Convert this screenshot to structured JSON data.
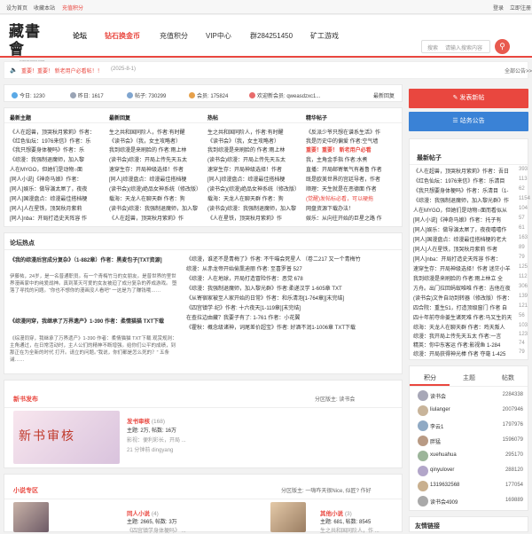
{
  "topbar": {
    "homepage": "设为首页",
    "bookmark": "收藏本站",
    "recharge": "充值积分",
    "login": "登录",
    "register": "立即注册"
  },
  "logo": {
    "text": "藏書會",
    "sub": "CANGSHUHUI.COM"
  },
  "nav": [
    "论坛",
    "钻石换金币",
    "充值积分",
    "VIP中心",
    "群284251450",
    "矿工游戏"
  ],
  "search": {
    "label": "搜索",
    "placeholder": "请输入搜索内容"
  },
  "notice": {
    "icon": "speaker-icon",
    "text": "重要！重要！ 新老用户必看帖！！",
    "date": "(2025-8-1)",
    "all": "全部公告>>"
  },
  "stats": {
    "today": "今日: 1230",
    "yesterday": "昨日: 1617",
    "posts": "帖子: 730299",
    "members": "会员: 175824",
    "welcome": "欢迎新会员: qweasdzxc1...",
    "latest": "最新回复"
  },
  "cols": [
    {
      "title": "最新主题",
      "items": [
        "《人在超兽，顶哭秋月紫莉》作者：",
        "《红色仙坛：1976来信》作者：乐",
        "《我只想要身体梗吗》作者：乐",
        "《综漫：我强制退魔师，加入黎",
        "人在MYGO，但她们是动物○面",
        "[同人小说]《神奇马娘》作者：",
        "[同人]娱乐：做导演太屌了，夜夜",
        "[同人]国漫盘点：综漫最佳搭档梗",
        "[同人]人在星铁，顶哭秋月紫莉",
        "[同人]nba：开局打造史天阵容 作"
      ]
    },
    {
      "title": "最新回复",
      "items": [
        "生之共和国同阶人，作者:有时醒",
        "《读书会》（我，女主攻略者）",
        "我到综漫是来刷脸的 作者:雨上林",
        "(读书会)综漫：开局上传先天五太",
        "速穿生存：开局神级选择！作者",
        "[同人]综漫盘点：综漫最佳搭档梗",
        "(读书会)(综漫)绝品女神系统（修改版）",
        "载海：天龙人在聊天群 作者：狗",
        "(读书会)综漫：我强制退魔师，加入黎",
        "《人在超兽，顶哭秋月紫莉》作"
      ]
    },
    {
      "title": "热帖",
      "items": [
        "生之共和国同阶人，作者:有时醒",
        "《读书会》（我，女主攻略者）",
        "我到综漫是来刷脸的 作者:雨上林",
        "(读书会)综漫：开局上传先天五太",
        "速穿生存：开局神级选择！作者",
        "[同人]综漫盘点：综漫最佳搭档梗",
        "(读书会)(综漫)绝品女神系统（修改版）",
        "载海：天龙人在聊天群 作者：狗",
        "(读书会)综漫：我强制退魔师，加入黎",
        "《人在星铁，顶哭秋月紫莉》作"
      ]
    },
    {
      "title": "精华帖子",
      "items": [
        "《反派少爷只想在谱系生活》作",
        "我是历史中的偏爱 作者:空气墙",
        "重要！重要！ 新老用户必看",
        "我，主角金手指 作者:水煮",
        "直播：开局邮寄氧气有着鲁 作者",
        "既是欧美世界的宫廷导者，作者",
        "顺理：天生就是在恶德面 作者",
        "(觉醒)发帖标必看，可以硬拖",
        "网盘资源下载办法！",
        "娱乐：从向往开始的巨星之路 作"
      ]
    }
  ],
  "hot_title": "论坛热点",
  "hot_left": [
    {
      "title": "《我的综漫后宫成分复杂》（1-882章）作者：黑麦包子[TXT资源]",
      "body": "伊藤祐，24岁，是一名普通职员。有一个青梅竹马的女朋友。是普世界的里世界漫画家中的纯爱战神。真到某天可爱的女友被迫了成分复杂的养成游戏。 堕落了寻找的问题。“你也不想你的漫画没人看吧” 一这是为了赚钱哦……"
    },
    {
      "title": "《综漫同穿，我继承了万界遗产》1-390 作者：柔情猫猫 TXT下载",
      "body": "《综漫同穿，我继承了万界遗产》1-390 作者：柔情猫猫 TXT下载 观赏规则：主角通过，在日常活动时，主人公们的精神不断增强。给你们公平的成绩，到那正在为全新的时代 打开。请立的问题。”我说，你们都是怎么死的？” 五条诫……"
    }
  ],
  "hot_right": [
    "《综漫，谁还不是青梅了》作者: 不牛喵会死星人 （卷二217 又一个青梅竹",
    "综漫：从赤龙帝开始偷熏迪丽 作者: 至喜罗普 527",
    "《综漫：人在地球，开局打造冒险作者：恶党 678",
    "《综漫：我强制退魔师，加入黎光群》作者:柔递汉学 1-605章 TXT",
    "《从寄宿家被至人家开始的日常》作者：和乐清泡[1-764章][末完结]",
    "《四宫镇学·纪》作者: 十六夜天[1-119章][末完结]",
    "在查拉边由藏？我要子有了: 1-761 作者：小花翼",
    "《霍秋：概念级诸神，词尾差价超宝》作者: 好酒不润1-1006章 TXT下载"
  ],
  "newbook": {
    "title": "新书发布",
    "badge": "分区版主: 读书会",
    "cover_text": "新书审核",
    "name": "发书审核",
    "count": "(168)",
    "stats": "主题: 2万, 帖数: 16万",
    "desc": "发书审核 ...",
    "mod": "影视：便利彩长，开局 ...",
    "user": "21 分钟前 dingyang"
  },
  "novel": {
    "title": "小说专区",
    "badge": "分区版主: 一嗨咋天很Nice, 似匠? 作好",
    "item1": {
      "name": "同人小说",
      "count": "(4)",
      "stats": "主题: 2665, 帖数: 3万",
      "desc": "《四宫镇学身体梗吗》 ...",
      "user": "26 分钟前 dingyang"
    },
    "item2": {
      "name": "其他小说",
      "count": "(3)",
      "stats": "主题: 681, 帖数: 8545",
      "desc": "生之共和国同阶人，作 ...",
      "user": "33 分钟前 ..."
    }
  },
  "buttons": {
    "post": "发表新帖",
    "announce": "站务公告"
  },
  "newpost_title": "最新帖子",
  "newposts": [
    {
      "t": "《人在超兽，顶哭秋月紫莉》作者：吾日",
      "c": "393"
    },
    {
      "t": "《红色仙坛：1976来信》作者：乐清目",
      "c": "113"
    },
    {
      "t": "《我只想要身体梗吗》作者：乐清目（1-",
      "c": "62"
    },
    {
      "t": "《综漫：我强制退魔师，加入黎光群》作",
      "c": "1154"
    },
    {
      "t": "人在MYGO，但她们是动物○面而看似从",
      "c": "104"
    },
    {
      "t": "[同人小说]《神奇马娘》作者：托子有",
      "c": "57"
    },
    {
      "t": "[同人]娱乐：做导演太屌了，夜夜嘻嘻作",
      "c": "61"
    },
    {
      "t": "[同人]国漫盘点：综漫最佳搭档梗的老大",
      "c": "163"
    },
    {
      "t": "[同人]人在星铁，顶哭秋月紫莉 作者",
      "c": "89"
    },
    {
      "t": "[同人]nba：开局打造史天阵容 作者：",
      "c": "79"
    },
    {
      "t": "速穿生存：开局神级选择！作者 迷茫小羊",
      "c": "125"
    },
    {
      "t": "我到综漫是来刷脸的 作者:雨上林立 全",
      "c": "112"
    },
    {
      "t": "方舟。出门拉回蚂蚁唯唯 作者：吉他在夜",
      "c": "306"
    },
    {
      "t": "(读书会)文件自动到转器（修改版）作者：",
      "c": "139"
    },
    {
      "t": "四合院：重生51，打造顶级窗门 作者 自",
      "c": "121"
    },
    {
      "t": "四十年前夺命姜生诸死难 作者:马又生的天",
      "c": "56"
    },
    {
      "t": "综海：天龙人在聊天群 作者：鸡天叛人",
      "c": "103"
    },
    {
      "t": "综漫：我开局上传先天五太 作者:一言",
      "c": "123"
    },
    {
      "t": "精英：你中东客运 作者:影视鱼 1-284",
      "c": "74"
    },
    {
      "t": "综漫：开局获得神光棒 作者 夺毫 1-425",
      "c": "79"
    },
    {
      "t": "同时穿越，但我在霍格沃茨 作者：天外美鱼",
      "c": "58"
    }
  ],
  "rank": {
    "tabs": [
      "积分",
      "主题",
      "帖数"
    ],
    "rows": [
      {
        "n": "读书会",
        "v": "2284338"
      },
      {
        "n": "liulanger",
        "v": "2007946"
      },
      {
        "n": "李云1",
        "v": "1797976"
      },
      {
        "n": "胖猛",
        "v": "1596079"
      },
      {
        "n": "xuehuahua",
        "v": "295170"
      },
      {
        "n": "qinyulover",
        "v": "288120"
      },
      {
        "n": "1319632568",
        "v": "177054"
      },
      {
        "n": "读书会4909",
        "v": "169889"
      }
    ]
  },
  "friend_title": "友情链接",
  "colors": {
    "accent": "#e9473f",
    "blue": "#1f6fb5",
    "btnRed": "#e9473f",
    "btnBlue": "#3a82d6"
  }
}
